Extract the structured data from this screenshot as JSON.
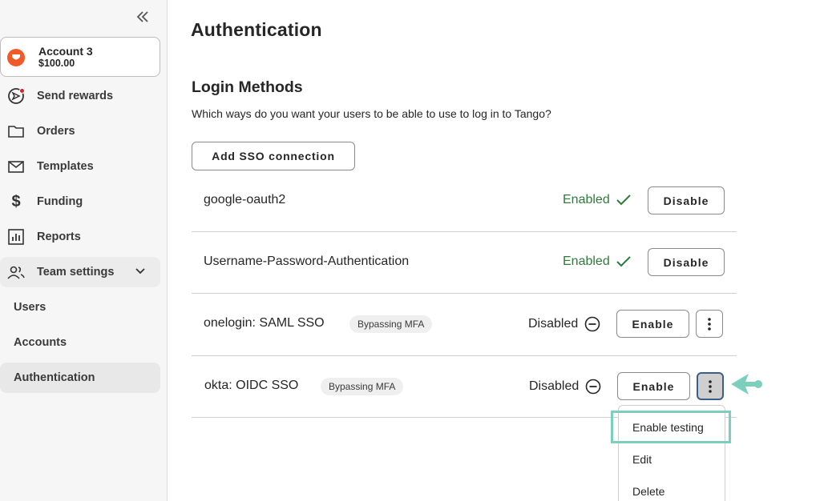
{
  "sidebar": {
    "account": {
      "name": "Account 3",
      "balance": "$100.00"
    },
    "items": [
      {
        "label": "Send rewards",
        "icon": "send-rewards-icon"
      },
      {
        "label": "Orders",
        "icon": "folder-icon"
      },
      {
        "label": "Templates",
        "icon": "envelope-icon"
      },
      {
        "label": "Funding",
        "icon": "dollar-icon"
      },
      {
        "label": "Reports",
        "icon": "chart-icon"
      },
      {
        "label": "Team settings",
        "icon": "team-icon"
      }
    ],
    "subitems": [
      {
        "label": "Users"
      },
      {
        "label": "Accounts"
      },
      {
        "label": "Authentication"
      }
    ]
  },
  "main": {
    "title": "Authentication",
    "section_title": "Login Methods",
    "description": "Which ways do you want your users to be able to use to log in to Tango?",
    "add_button": "Add SSO connection",
    "methods": [
      {
        "name": "google-oauth2",
        "status": "Enabled",
        "action": "Disable"
      },
      {
        "name": "Username-Password-Authentication",
        "status": "Enabled",
        "action": "Disable"
      },
      {
        "name": "onelogin: SAML SSO",
        "tag": "Bypassing MFA",
        "status": "Disabled",
        "action": "Enable"
      },
      {
        "name": "okta: OIDC SSO",
        "tag": "Bypassing MFA",
        "status": "Disabled",
        "action": "Enable"
      }
    ],
    "dropdown": {
      "options": [
        {
          "label": "Enable testing"
        },
        {
          "label": "Edit"
        },
        {
          "label": "Delete"
        }
      ]
    }
  },
  "colors": {
    "accent_orange": "#f05a28",
    "enabled_green": "#2f7a3b",
    "highlight_teal": "#7ccfbc",
    "notification_red": "#e02020"
  }
}
